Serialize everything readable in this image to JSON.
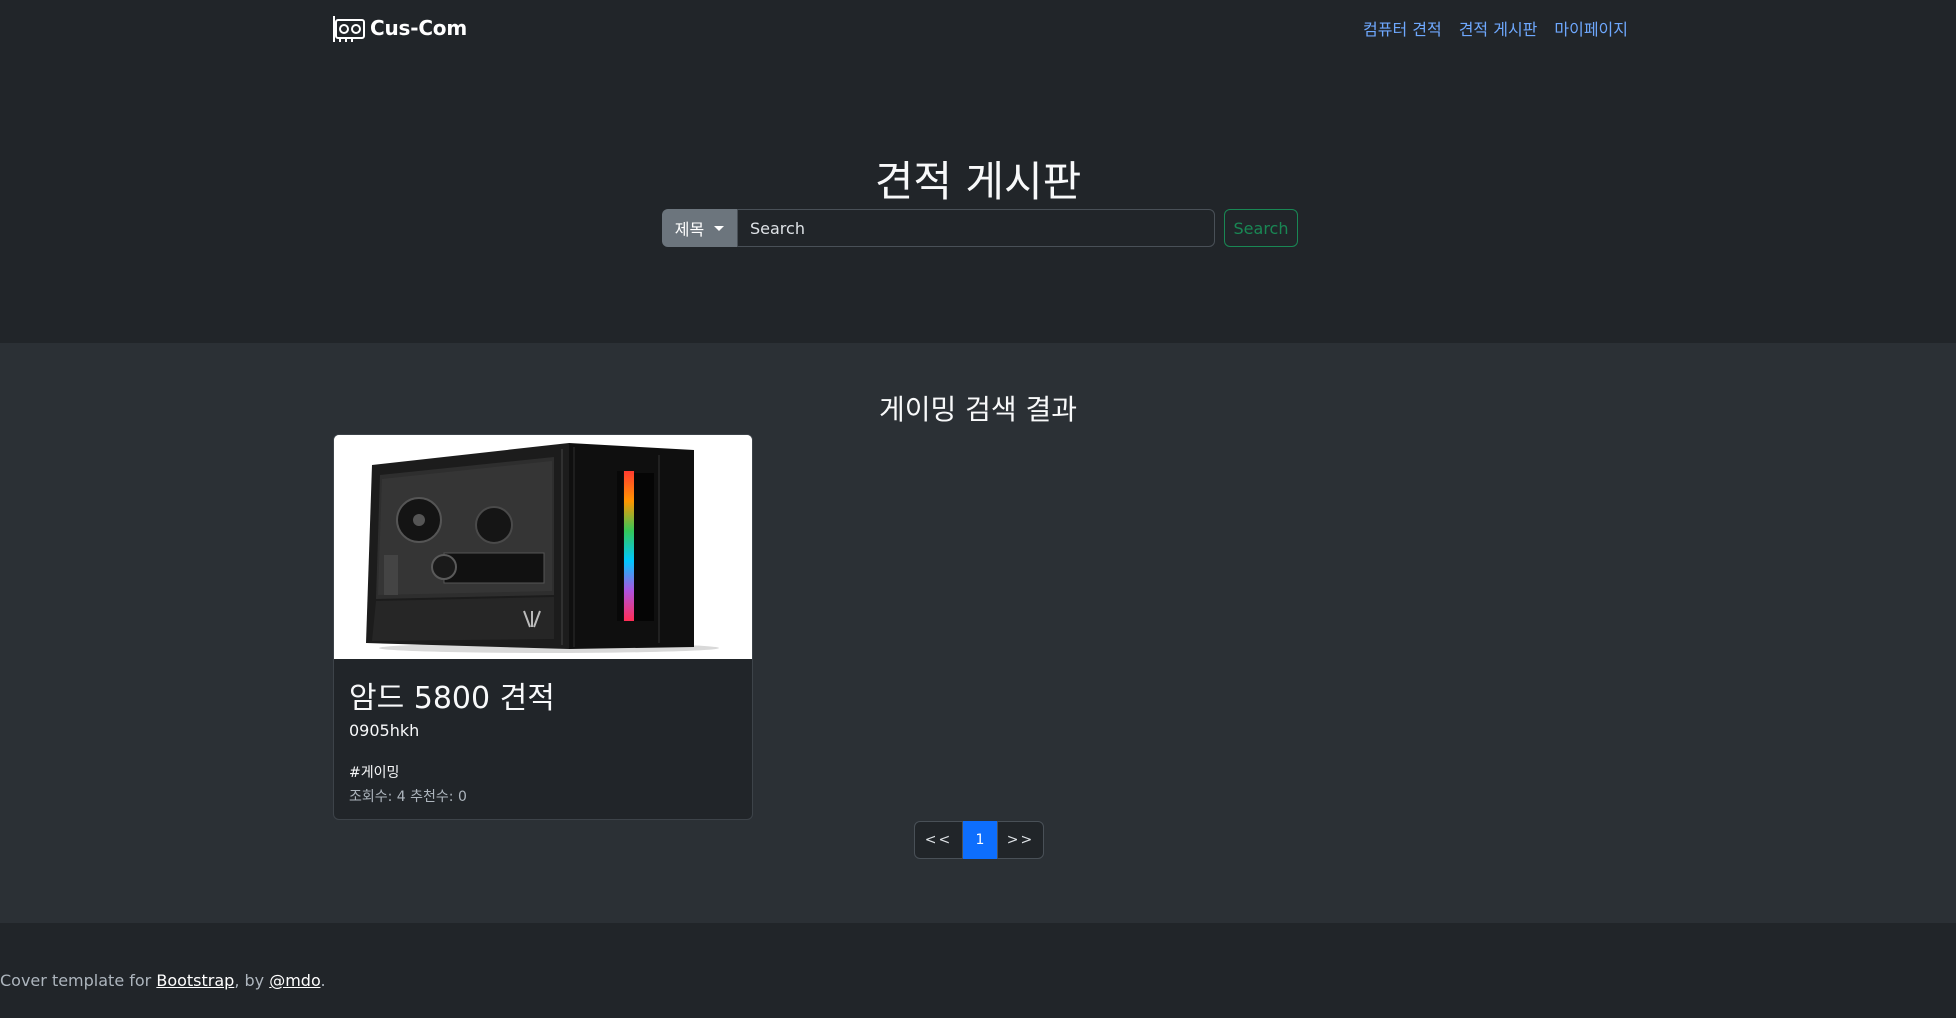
{
  "brand": {
    "name": "Cus-Com",
    "icon": "graphics-card-icon"
  },
  "nav": {
    "items": [
      {
        "label": "컴퓨터 견적"
      },
      {
        "label": "견적 게시판"
      },
      {
        "label": "마이페이지"
      }
    ]
  },
  "hero": {
    "title": "견적 게시판"
  },
  "search": {
    "filter_label": "제목",
    "placeholder": "Search",
    "value": "",
    "button_label": "Search"
  },
  "results": {
    "title": "게이밍 검색 결과",
    "cards": [
      {
        "title": "암드 5800 견적",
        "author": "0905hkh",
        "tag": "#게이밍",
        "stats": "조회수: 4 추천수: 0",
        "image": "pc-case-image"
      }
    ]
  },
  "pagination": {
    "prev": "<<",
    "current": "1",
    "next": ">>"
  },
  "footer": {
    "prefix": "Cover template for ",
    "link1": "Bootstrap",
    "middle": ", by ",
    "link2": "@mdo",
    "suffix": "."
  },
  "colors": {
    "background": "#212529",
    "section": "#2b3035",
    "link": "#6ea8fe",
    "success": "#198754",
    "primary": "#0d6efd",
    "secondary": "#6c757d"
  }
}
